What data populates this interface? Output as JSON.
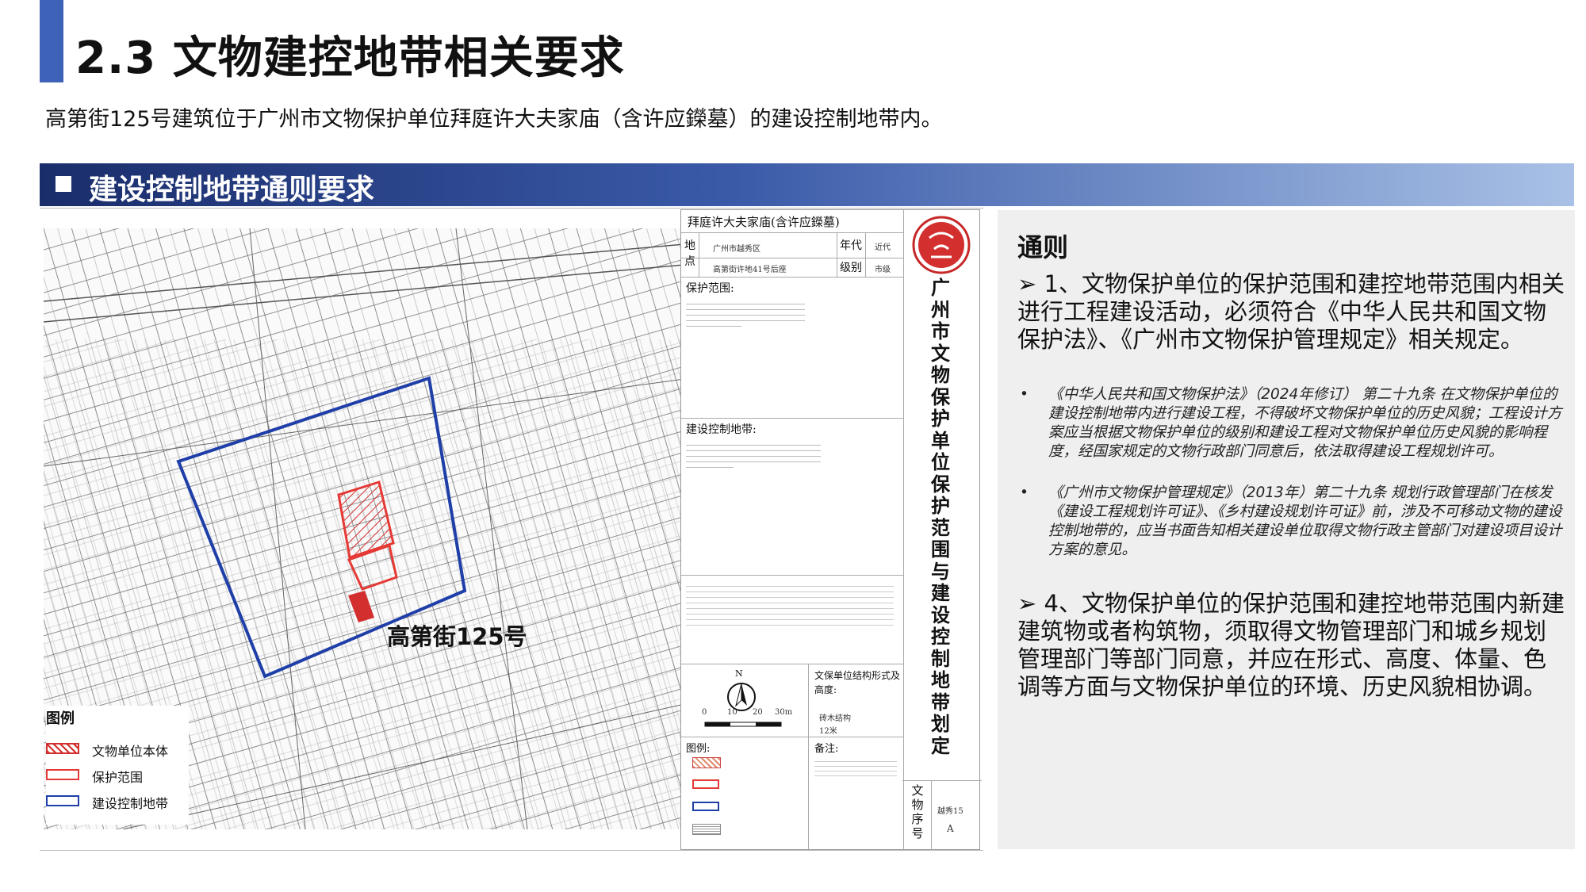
{
  "header": {
    "title": "2.3 文物建控地带相关要求",
    "intro": "高第街125号建筑位于广州市文物保护单位拜庭许大夫家庙（含许应鑅墓）的建设控制地带内。",
    "accent_color": "#3e62b8"
  },
  "section": {
    "title": "建设控制地带通则要求"
  },
  "map": {
    "building_label": "高第街125号",
    "legend": {
      "title": "图例",
      "items": [
        {
          "label": "文物单位本体",
          "color": "#d32f2f"
        },
        {
          "label": "保护范围",
          "color": "#e53935"
        },
        {
          "label": "建设控制地带",
          "color": "#1f3fa8"
        }
      ]
    }
  },
  "card": {
    "title": "拜庭许大夫家庙(含许应鑅墓)",
    "address_label": "地点",
    "address_1": "广州市越秀区",
    "address_2": "高第街许地41号后座",
    "era_label": "年代",
    "era_value": "近代",
    "level_label": "级别",
    "level_value": "市级",
    "protection_label": "保护范围:",
    "control_label": "建设控制地带:",
    "north_label": "N",
    "structure_label": "文保单位结构形式及高度:",
    "structure_1": "砖木结构",
    "structure_2": "12米",
    "legend_label": "图例:",
    "notes_label": "备注:",
    "serial_label": "文物序号",
    "serial_value": "越秀15",
    "serial_letter": "A",
    "vertical_title": "广州市文物保护单位保护范围与建设控制地带划定",
    "scale_ticks": [
      "0",
      "10",
      "20",
      "30m"
    ]
  },
  "rules": {
    "title": "通则",
    "rule1": "➢  1、文物保护单位的保护范围和建控地带范围内相关进行工程建设活动，必须符合《中华人民共和国文物保护法》、《广州市文物保护管理规定》相关规定。",
    "bullet1": "《中华人民共和国文物保护法》（2024年修订）  第二十九条  在文物保护单位的建设控制地带内进行建设工程，不得破坏文物保护单位的历史风貌；工程设计方案应当根据文物保护单位的级别和建设工程对文物保护单位历史风貌的影响程度，经国家规定的文物行政部门同意后，依法取得建设工程规划许可。",
    "bullet2": "《广州市文物保护管理规定》（2013年）第二十九条  规划行政管理部门在核发《建设工程规划许可证》、《乡村建设规划许可证》前，涉及不可移动文物的建设控制地带的，应当书面告知相关建设单位取得文物行政主管部门对建设项目设计方案的意见。",
    "rule4": "➢  4、文物保护单位的保护范围和建控地带范围内新建建筑物或者构筑物，须取得文物管理部门和城乡规划管理部门等部门同意，并应在形式、高度、体量、色调等方面与文物保护单位的环境、历史风貌相协调。"
  }
}
